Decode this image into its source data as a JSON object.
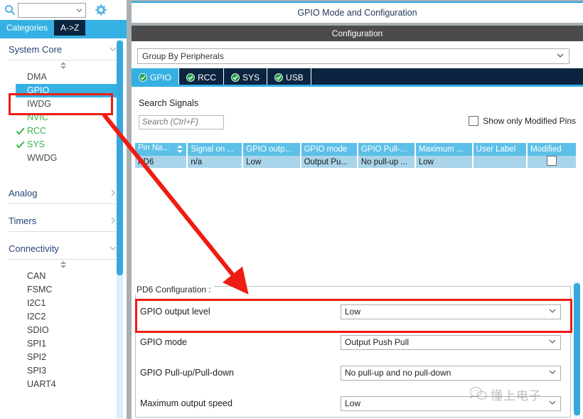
{
  "colors": {
    "accent_blue": "#35b0e3",
    "dark_navy": "#0b2440",
    "table_header": "#5cc0e8",
    "table_row": "#a9d4ea",
    "green_check": "#3bb44a",
    "annotation_red": "#ee1c12",
    "config_bar": "#4b4b4b"
  },
  "sidebar": {
    "search": {
      "value": "",
      "placeholder": ""
    },
    "gear_icon": "gear-icon",
    "search_icon": "search-icon",
    "tabs": [
      {
        "label": "Categories",
        "selected": true
      },
      {
        "label": "A->Z",
        "selected": false
      }
    ],
    "groups": [
      {
        "label": "System Core",
        "expanded": true,
        "items": [
          {
            "label": "DMA",
            "state": "normal"
          },
          {
            "label": "GPIO",
            "state": "selected"
          },
          {
            "label": "IWDG",
            "state": "normal"
          },
          {
            "label": "NVIC",
            "state": "configured"
          },
          {
            "label": "RCC",
            "state": "checked"
          },
          {
            "label": "SYS",
            "state": "checked"
          },
          {
            "label": "WWDG",
            "state": "normal"
          }
        ]
      },
      {
        "label": "Analog",
        "expanded": false,
        "items": []
      },
      {
        "label": "Timers",
        "expanded": false,
        "items": []
      },
      {
        "label": "Connectivity",
        "expanded": true,
        "items": [
          {
            "label": "CAN",
            "state": "normal"
          },
          {
            "label": "FSMC",
            "state": "normal"
          },
          {
            "label": "I2C1",
            "state": "normal"
          },
          {
            "label": "I2C2",
            "state": "normal"
          },
          {
            "label": "SDIO",
            "state": "normal"
          },
          {
            "label": "SPI1",
            "state": "normal"
          },
          {
            "label": "SPI2",
            "state": "normal"
          },
          {
            "label": "SPI3",
            "state": "normal"
          },
          {
            "label": "UART4",
            "state": "normal"
          }
        ]
      }
    ]
  },
  "main": {
    "title": "GPIO Mode and Configuration",
    "config_bar": "Configuration",
    "group_by": "Group By Peripherals",
    "peripheral_tabs": [
      {
        "label": "GPIO",
        "active": true,
        "icon": "check-circle-icon"
      },
      {
        "label": "RCC",
        "active": false,
        "icon": "check-circle-icon"
      },
      {
        "label": "SYS",
        "active": false,
        "icon": "check-circle-icon"
      },
      {
        "label": "USB",
        "active": false,
        "icon": "check-circle-icon"
      }
    ],
    "search_signals": {
      "label": "Search Signals",
      "value": "",
      "placeholder": "Search (Ctrl+F)"
    },
    "modified_pins": {
      "label": "Show only Modified Pins",
      "checked": false
    },
    "table": {
      "columns": [
        "Pin Na...",
        "Signal on ...",
        "GPIO outp...",
        "GPIO mode",
        "GPIO Pull-...",
        "Maximum ...",
        "User Label",
        "Modified"
      ],
      "rows": [
        {
          "pin_name": "PD6",
          "signal_on": "n/a",
          "gpio_output": "Low",
          "gpio_mode": "Output Pu...",
          "gpio_pull": "No pull-up ...",
          "maximum": "Low",
          "user_label": "",
          "modified": false
        }
      ]
    },
    "pd6": {
      "legend": "PD6 Configuration :",
      "rows": [
        {
          "label": "GPIO output level",
          "value": "Low"
        },
        {
          "label": "GPIO mode",
          "value": "Output Push Pull"
        },
        {
          "label": "GPIO Pull-up/Pull-down",
          "value": "No pull-up and no pull-down"
        },
        {
          "label": "Maximum output speed",
          "value": "Low"
        }
      ]
    }
  },
  "watermark": {
    "text": "懂上电子",
    "icon": "wechat-icon"
  }
}
